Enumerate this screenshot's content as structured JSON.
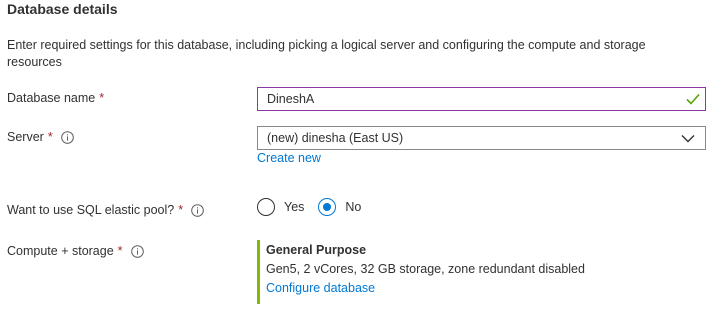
{
  "section": {
    "title": "Database details",
    "description": "Enter required settings for this database, including picking a logical server and configuring the compute and storage resources"
  },
  "fields": {
    "database_name": {
      "label": "Database name",
      "required": "*",
      "value": "DineshA"
    },
    "server": {
      "label": "Server",
      "required": "*",
      "value": "(new) dinesha (East US)",
      "create_link": "Create new"
    },
    "elastic_pool": {
      "label": "Want to use SQL elastic pool?",
      "required": "*",
      "options": [
        "Yes",
        "No"
      ],
      "selected": "No"
    },
    "compute_storage": {
      "label": "Compute + storage",
      "required": "*",
      "tier": "General Purpose",
      "spec": "Gen5, 2 vCores, 32 GB storage, zone redundant disabled",
      "configure_link": "Configure database"
    }
  },
  "icons": {
    "info": "info-icon",
    "valid": "checkmark-icon",
    "dropdown": "chevron-down-icon"
  },
  "colors": {
    "accent": "#0078d4",
    "required": "#a4262c",
    "valid": "#57a300",
    "tier_bar": "#7fba00",
    "input_active_border": "#8a3a9e"
  }
}
